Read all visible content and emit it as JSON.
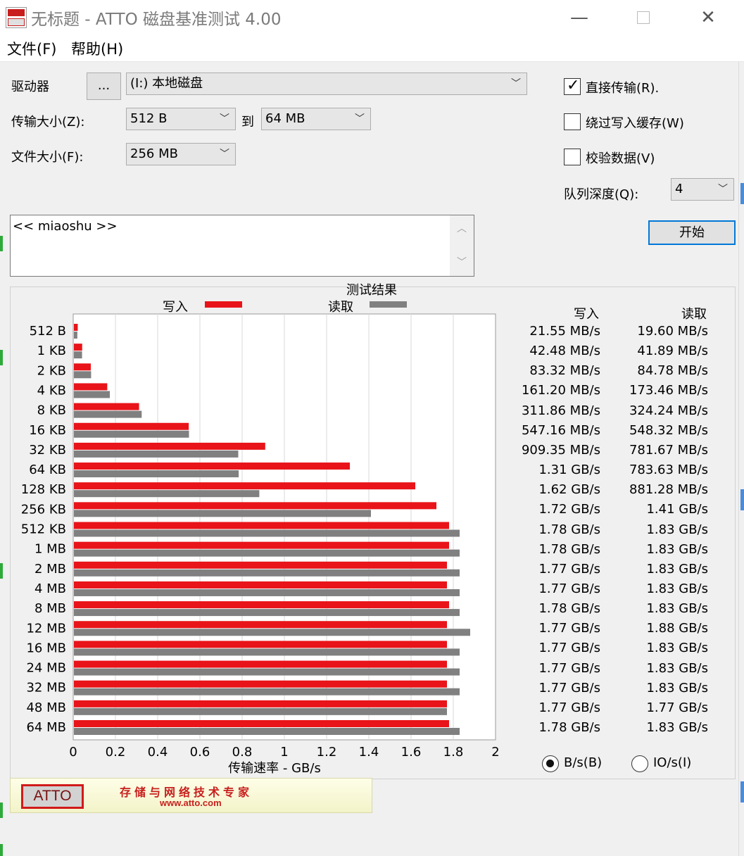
{
  "window": {
    "title": "无标题 - ATTO 磁盘基准测试 4.00",
    "minimize": "—",
    "close": "✕"
  },
  "menu": {
    "file": "文件(F)",
    "help": "帮助(H)"
  },
  "form": {
    "drive_label": "驱动器",
    "browse_label": "...",
    "drive_value": "(I:) 本地磁盘",
    "transfer_label": "传输大小(Z):",
    "transfer_min": "512 B",
    "to_label": "到",
    "transfer_max": "64 MB",
    "filesize_label": "文件大小(F):",
    "filesize_value": "256 MB",
    "direct_io_label": "直接传输(R).",
    "direct_io_checked": true,
    "bypass_label": "绕过写入缓存(W)",
    "bypass_checked": false,
    "verify_label": "校验数据(V)",
    "verify_checked": false,
    "queue_label": "队列深度(Q):",
    "queue_value": "4",
    "description": "<< miaoshu >>",
    "start_label": "开始"
  },
  "results": {
    "title": "测试结果",
    "legend_write": "写入",
    "legend_read": "读取",
    "col_write": "写入",
    "col_read": "读取",
    "write_color": "#e81419",
    "read_color": "#808080",
    "rows": [
      {
        "size": "512 B",
        "write": "21.55 MB/s",
        "read": "19.60 MB/s"
      },
      {
        "size": "1 KB",
        "write": "42.48 MB/s",
        "read": "41.89 MB/s"
      },
      {
        "size": "2 KB",
        "write": "83.32 MB/s",
        "read": "84.78 MB/s"
      },
      {
        "size": "4 KB",
        "write": "161.20 MB/s",
        "read": "173.46 MB/s"
      },
      {
        "size": "8 KB",
        "write": "311.86 MB/s",
        "read": "324.24 MB/s"
      },
      {
        "size": "16 KB",
        "write": "547.16 MB/s",
        "read": "548.32 MB/s"
      },
      {
        "size": "32 KB",
        "write": "909.35 MB/s",
        "read": "781.67 MB/s"
      },
      {
        "size": "64 KB",
        "write": "1.31 GB/s",
        "read": "783.63 MB/s"
      },
      {
        "size": "128 KB",
        "write": "1.62 GB/s",
        "read": "881.28 MB/s"
      },
      {
        "size": "256 KB",
        "write": "1.72 GB/s",
        "read": "1.41 GB/s"
      },
      {
        "size": "512 KB",
        "write": "1.78 GB/s",
        "read": "1.83 GB/s"
      },
      {
        "size": "1 MB",
        "write": "1.78 GB/s",
        "read": "1.83 GB/s"
      },
      {
        "size": "2 MB",
        "write": "1.77 GB/s",
        "read": "1.83 GB/s"
      },
      {
        "size": "4 MB",
        "write": "1.77 GB/s",
        "read": "1.83 GB/s"
      },
      {
        "size": "8 MB",
        "write": "1.78 GB/s",
        "read": "1.83 GB/s"
      },
      {
        "size": "12 MB",
        "write": "1.77 GB/s",
        "read": "1.88 GB/s"
      },
      {
        "size": "16 MB",
        "write": "1.77 GB/s",
        "read": "1.83 GB/s"
      },
      {
        "size": "24 MB",
        "write": "1.77 GB/s",
        "read": "1.83 GB/s"
      },
      {
        "size": "32 MB",
        "write": "1.77 GB/s",
        "read": "1.83 GB/s"
      },
      {
        "size": "48 MB",
        "write": "1.77 GB/s",
        "read": "1.77 GB/s"
      },
      {
        "size": "64 MB",
        "write": "1.78 GB/s",
        "read": "1.83 GB/s"
      }
    ],
    "units_bps": "B/s(B)",
    "units_iops": "IO/s(I)",
    "units_selected": "bps"
  },
  "chart_data": {
    "type": "bar",
    "orientation": "horizontal",
    "xlabel": "传输速率 - GB/s",
    "xlim": [
      0,
      2
    ],
    "xticks": [
      "0",
      "0.2",
      "0.4",
      "0.6",
      "0.8",
      "1",
      "1.2",
      "1.4",
      "1.6",
      "1.8",
      "2"
    ],
    "grid": true,
    "categories": [
      "512 B",
      "1 KB",
      "2 KB",
      "4 KB",
      "8 KB",
      "16 KB",
      "32 KB",
      "64 KB",
      "128 KB",
      "256 KB",
      "512 KB",
      "1 MB",
      "2 MB",
      "4 MB",
      "8 MB",
      "12 MB",
      "16 MB",
      "24 MB",
      "32 MB",
      "48 MB",
      "64 MB"
    ],
    "series": [
      {
        "name": "写入",
        "color": "#e81419",
        "values": [
          0.02155,
          0.04248,
          0.08332,
          0.1612,
          0.31186,
          0.54716,
          0.90935,
          1.31,
          1.62,
          1.72,
          1.78,
          1.78,
          1.77,
          1.77,
          1.78,
          1.77,
          1.77,
          1.77,
          1.77,
          1.77,
          1.78
        ]
      },
      {
        "name": "读取",
        "color": "#808080",
        "values": [
          0.0196,
          0.04189,
          0.08478,
          0.17346,
          0.32424,
          0.54832,
          0.78167,
          0.78363,
          0.88128,
          1.41,
          1.83,
          1.83,
          1.83,
          1.83,
          1.83,
          1.88,
          1.83,
          1.83,
          1.83,
          1.77,
          1.83
        ]
      }
    ]
  },
  "banner": {
    "logo": "ATTO",
    "slogan": "存储与网络技术专家",
    "url": "www.atto.com"
  }
}
